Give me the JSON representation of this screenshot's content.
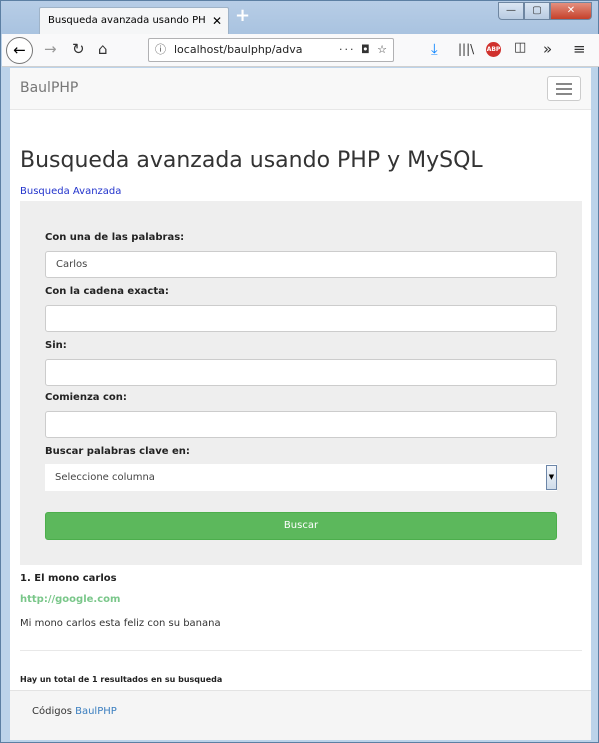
{
  "browser": {
    "tab_title": "Busqueda avanzada usando PHP y M",
    "tab_close": "✕",
    "new_tab": "+",
    "url": "localhost/baulphp/adva",
    "url_actions": "··· ◘ ☆",
    "win_min": "—",
    "win_max": "▢",
    "win_close": "✕"
  },
  "site": {
    "brand": "BaulPHP"
  },
  "page": {
    "title": "Busqueda avanzada usando PHP y MySQL",
    "breadcrumb": "Busqueda Avanzada"
  },
  "form": {
    "any_words_label": "Con una de las palabras:",
    "any_words_value": "Carlos",
    "exact_label": "Con la cadena exacta:",
    "exact_value": "",
    "without_label": "Sin:",
    "without_value": "",
    "starts_label": "Comienza con:",
    "starts_value": "",
    "column_label": "Buscar palabras clave en:",
    "column_selected": "Seleccione columna",
    "submit_label": "Buscar"
  },
  "results": {
    "items": [
      {
        "title": "1. El mono carlos",
        "link": "http://google.com",
        "description": "Mi mono carlos esta feliz con su banana"
      }
    ],
    "total_text": "Hay un total de 1 resultados en su busqueda"
  },
  "footer": {
    "prefix": "Códigos",
    "link": "BaulPHP"
  },
  "colors": {
    "primary_button": "#5cb85c",
    "link": "#2233cc",
    "result_link": "#7ac78a"
  }
}
